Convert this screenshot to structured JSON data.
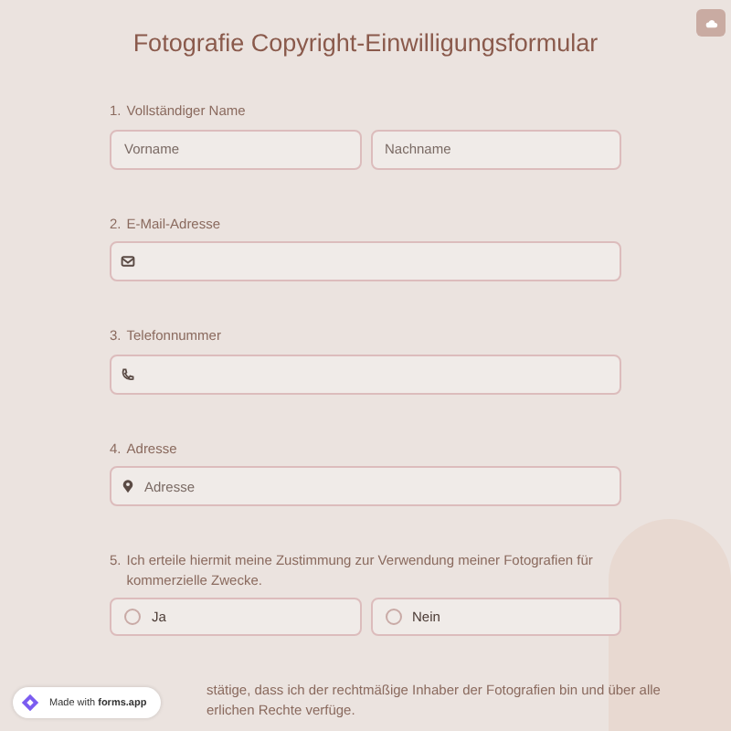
{
  "title": "Fotografie Copyright-Einwilligungsformular",
  "questions": [
    {
      "kind": "name",
      "number": "1.",
      "label": "Vollständiger Name",
      "fields": [
        {
          "placeholder": "Vorname"
        },
        {
          "placeholder": "Nachname"
        }
      ]
    },
    {
      "kind": "email",
      "number": "2.",
      "label": "E-Mail-Adresse"
    },
    {
      "kind": "phone",
      "number": "3.",
      "label": "Telefonnummer"
    },
    {
      "kind": "address",
      "number": "4.",
      "label": "Adresse",
      "fields": [
        {
          "placeholder": "Adresse"
        }
      ]
    },
    {
      "kind": "choice",
      "number": "5.",
      "label": "Ich erteile hiermit meine Zustimmung zur Verwendung meiner Fotografien für kommerzielle Zwecke.",
      "options": [
        {
          "label": "Ja",
          "selected": false
        },
        {
          "label": "Nein",
          "selected": false
        }
      ]
    },
    {
      "kind": "choice",
      "label_lines": [
        "stätige, dass ich der rechtmäßige Inhaber der Fotografien bin und über alle",
        "erlichen Rechte verfüge."
      ]
    }
  ],
  "badge": {
    "prefix": "Made with",
    "brand": "forms.app"
  }
}
